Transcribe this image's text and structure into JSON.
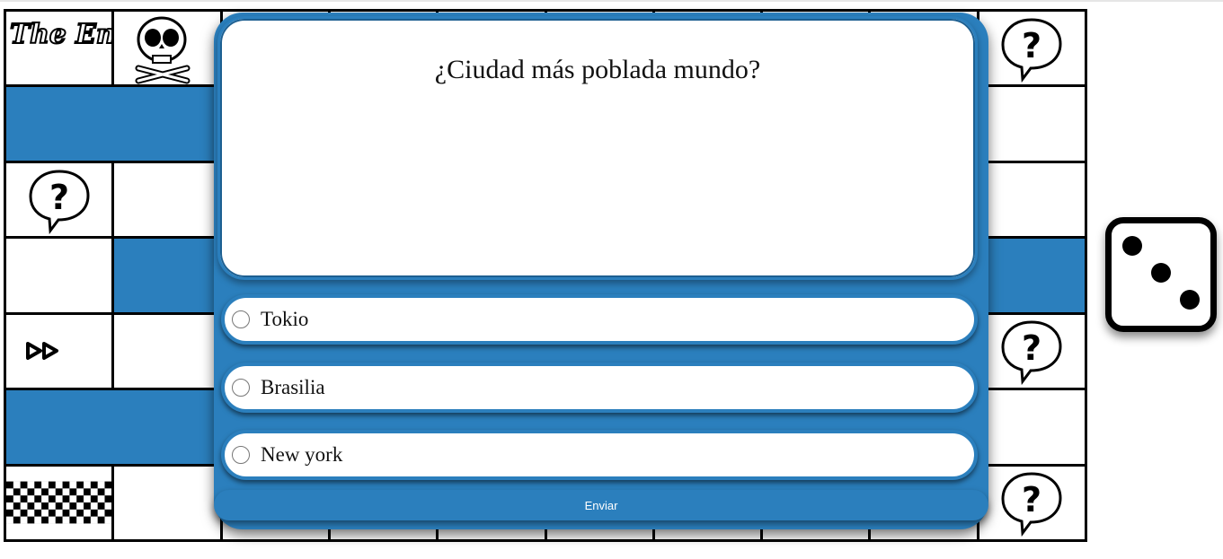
{
  "board": {
    "finish_tile_label": "The End"
  },
  "quiz": {
    "question": "¿Ciudad más poblada mundo?",
    "options": [
      "Tokio",
      "Brasilia",
      "New york"
    ],
    "submit_label": "Enviar"
  },
  "dice": {
    "value": 3
  },
  "colors": {
    "accent": "#2b7fbd",
    "board_lines": "#000000",
    "background": "#ffffff"
  }
}
